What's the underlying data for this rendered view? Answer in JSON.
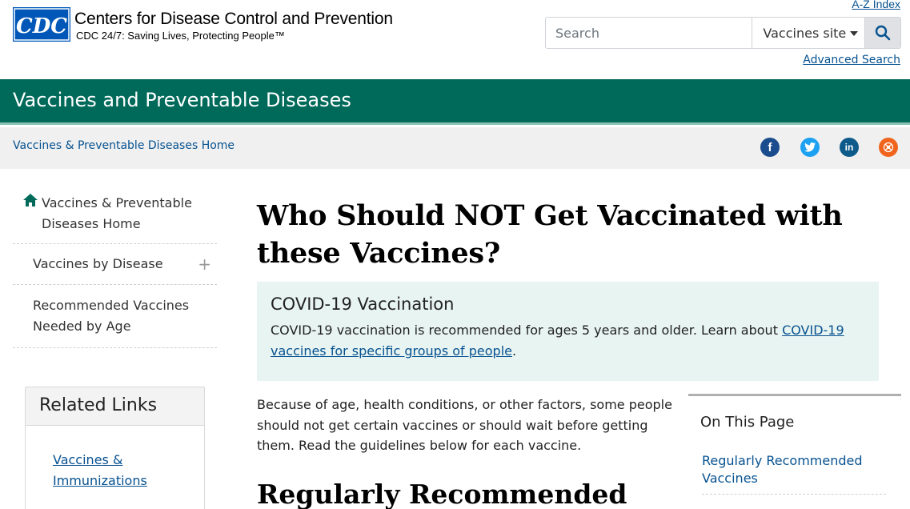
{
  "header": {
    "logo_text": "CDC",
    "org_name": "Centers for Disease Control and Prevention",
    "tagline": "CDC 24/7: Saving Lives, Protecting People™",
    "az_index": "A-Z Index",
    "search_placeholder": "Search",
    "search_scope": "Vaccines site",
    "advanced_search": "Advanced Search"
  },
  "site": {
    "title": "Vaccines and Preventable Diseases"
  },
  "breadcrumb": {
    "home": "Vaccines & Preventable Diseases Home"
  },
  "social": {
    "facebook": "f",
    "twitter": "t",
    "linkedin": "in",
    "syndicate": "s"
  },
  "leftnav": {
    "items": [
      {
        "label": "Vaccines & Preventable Diseases Home"
      },
      {
        "label": "Vaccines by Disease",
        "expand": "+"
      },
      {
        "label": "Recommended Vaccines Needed by Age"
      }
    ]
  },
  "related": {
    "title": "Related Links",
    "links": [
      "Vaccines & Immunizations"
    ]
  },
  "main": {
    "title": "Who Should NOT Get Vaccinated with these Vaccines?",
    "callout": {
      "title": "COVID-19 Vaccination",
      "text": "COVID-19 vaccination is recommended for ages 5 years and older. Learn about ",
      "link": "COVID-19 vaccines for specific groups of people",
      "end": "."
    },
    "intro": "Because of age, health conditions, or other factors, some people should not get certain vaccines or should wait before getting them. Read the guidelines below for each vaccine.",
    "section_heading": "Regularly Recommended"
  },
  "on_this_page": {
    "title": "On This Page",
    "links": [
      "Regularly Recommended Vaccines"
    ]
  },
  "colors": {
    "brand_green": "#006a5a",
    "link_blue": "#075290",
    "callout_bg": "#e8f4f2"
  }
}
